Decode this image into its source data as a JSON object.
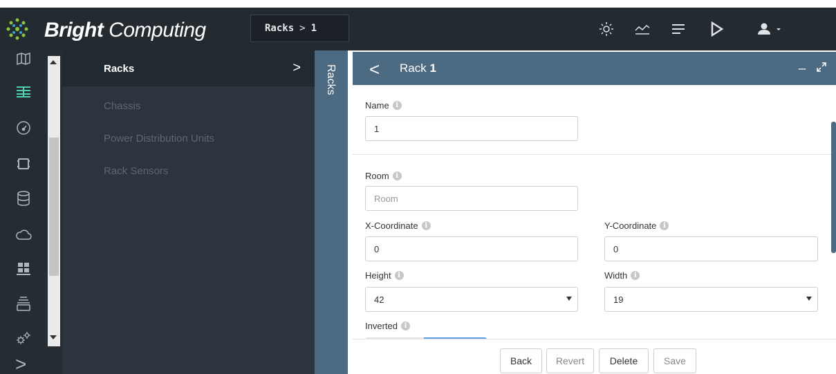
{
  "header": {
    "brand_bold": "Bright",
    "brand_light": " Computing",
    "breadcrumb": {
      "first": "Racks",
      "separator": ">",
      "second": "1"
    },
    "icons": [
      "settings-icon",
      "monitoring-chart-icon",
      "events-list-icon",
      "run-play-icon",
      "user-icon"
    ]
  },
  "sidebar": {
    "icons": [
      "map-icon",
      "racks-icon",
      "dashboard-gauge-icon",
      "devices-icon",
      "database-icon",
      "cloud-icon",
      "grid-icon",
      "stack-icon",
      "gears-icon"
    ],
    "expand_label": ">"
  },
  "nav": {
    "items": [
      {
        "label": "Racks",
        "chevron": ">"
      },
      {
        "label": "Chassis"
      },
      {
        "label": "Power Distribution Units"
      },
      {
        "label": "Rack Sensors"
      }
    ]
  },
  "side_tab": {
    "label": "Racks"
  },
  "panel": {
    "back": "<",
    "title_prefix": "Rack ",
    "title_value": "1",
    "minimize": "_"
  },
  "form": {
    "name": {
      "label": "Name",
      "value": "1"
    },
    "room": {
      "label": "Room",
      "value": "",
      "placeholder": "Room"
    },
    "x_coordinate": {
      "label": "X-Coordinate",
      "value": "0"
    },
    "y_coordinate": {
      "label": "Y-Coordinate",
      "value": "0"
    },
    "height": {
      "label": "Height",
      "value": "42"
    },
    "width": {
      "label": "Width",
      "value": "19"
    },
    "inverted": {
      "label": "Inverted"
    },
    "info_glyph": "i"
  },
  "footer": {
    "back": "Back",
    "revert": "Revert",
    "delete": "Delete",
    "save": "Save"
  },
  "colors": {
    "header_bg": "#232a30",
    "panel_header": "#4d6a83",
    "accent_green": "#4fd1b0",
    "toggle_on": "#5a9fe0"
  }
}
